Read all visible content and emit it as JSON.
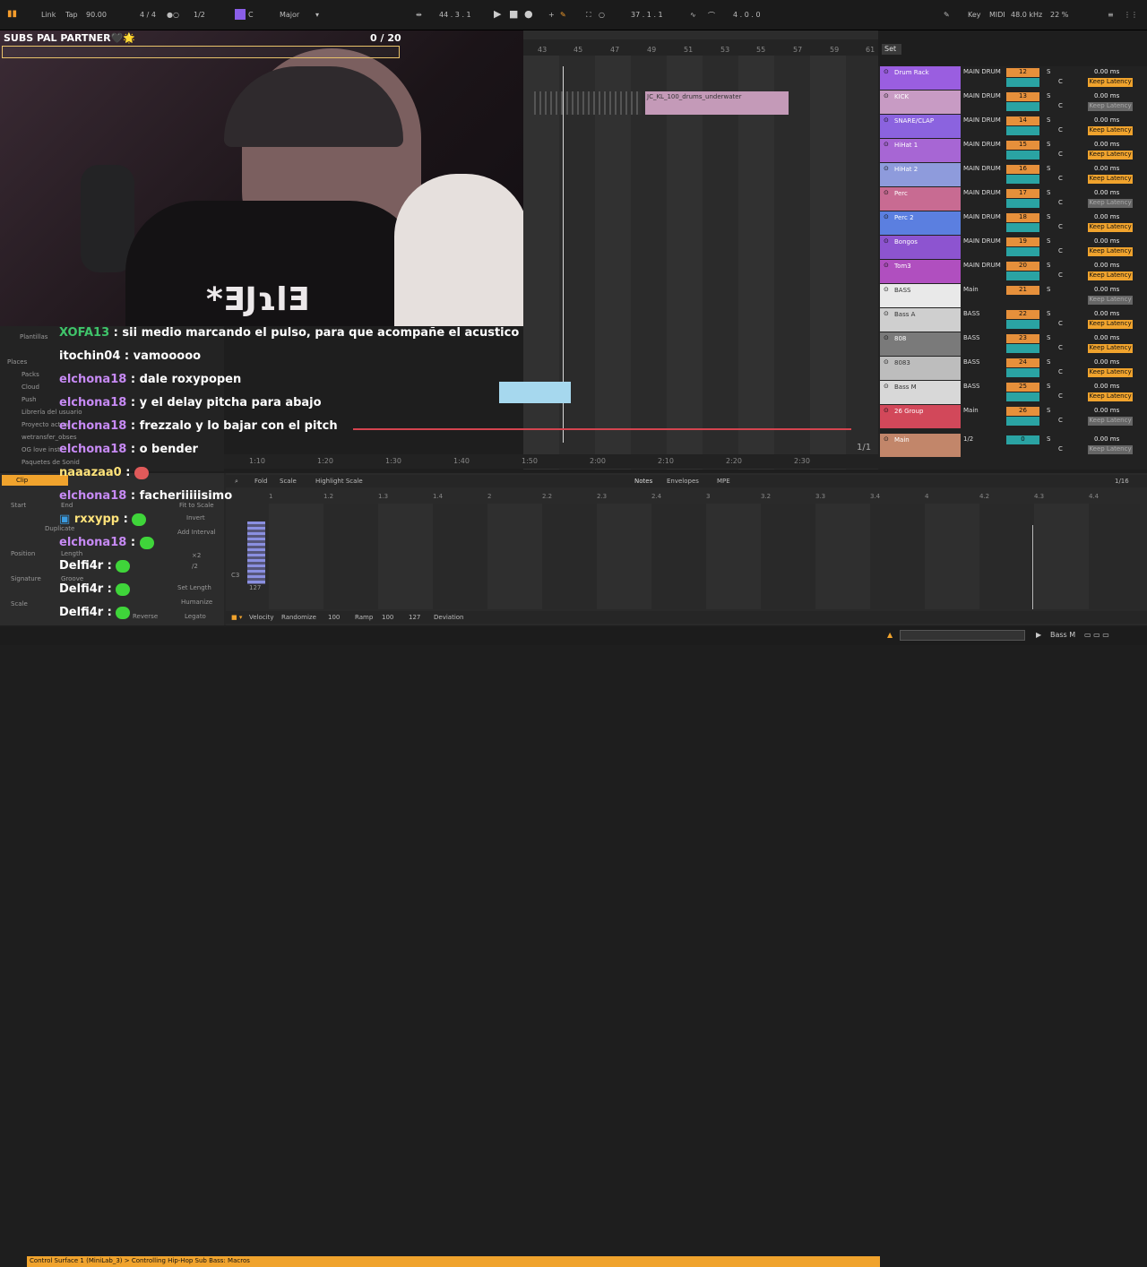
{
  "topbar": {
    "link": "Link",
    "tap": "Tap",
    "tempo": "90.00",
    "signature": "4 / 4",
    "quant": "1/2",
    "key_root": "C",
    "scale": "Major",
    "position": "44 . 3 . 1",
    "loop_pos": "37 . 1 . 1",
    "loop_len": "4 . 0 . 0",
    "key_label": "Key",
    "midi_label": "MIDI",
    "sample_rate": "48.0 kHz",
    "cpu": "22 %"
  },
  "video": {
    "overlay_title": "SUBS PAL PARTNER🖤🌟",
    "overlay_count": "0 / 20",
    "shirt_text": "*ƎJɿlƎ"
  },
  "arrangement": {
    "ruler": [
      "43",
      "45",
      "47",
      "49",
      "51",
      "53",
      "55",
      "57",
      "59",
      "61"
    ],
    "set_label": "Set",
    "clip_name": "JC_KL_100_drums_underwater",
    "timeline": [
      "1:10",
      "1:20",
      "1:30",
      "1:40",
      "1:50",
      "2:00",
      "2:10",
      "2:20",
      "2:30"
    ],
    "page": "1/1"
  },
  "tracks": [
    {
      "name": "Drum Rack",
      "io": "MAIN DRUM",
      "num": "12",
      "val": "0.00 ms",
      "lat": "Keep Latency",
      "color": "#9a5ee0"
    },
    {
      "name": "KICK",
      "io": "MAIN DRUM",
      "num": "13",
      "val": "0.00 ms",
      "lat": "Keep Latency",
      "color": "#c89bc4"
    },
    {
      "name": "SNARE/CLAP",
      "io": "MAIN DRUM",
      "num": "14",
      "val": "0.00 ms",
      "lat": "Keep Latency",
      "color": "#8b63df"
    },
    {
      "name": "HiHat 1",
      "io": "MAIN DRUM",
      "num": "15",
      "val": "0.00 ms",
      "lat": "Keep Latency",
      "color": "#a766d4"
    },
    {
      "name": "HiHat 2",
      "io": "MAIN DRUM",
      "num": "16",
      "val": "0.00 ms",
      "lat": "Keep Latency",
      "color": "#8e9bdc"
    },
    {
      "name": "Perc",
      "io": "MAIN DRUM",
      "num": "17",
      "val": "0.00 ms",
      "lat": "Keep Latency",
      "color": "#c86b92"
    },
    {
      "name": "Perc 2",
      "io": "MAIN DRUM",
      "num": "18",
      "val": "0.00 ms",
      "lat": "Keep Latency",
      "color": "#5b7fe0"
    },
    {
      "name": "Bongos",
      "io": "MAIN DRUM",
      "num": "19",
      "val": "0.00 ms",
      "lat": "Keep Latency",
      "color": "#8d54d0"
    },
    {
      "name": "Tom3",
      "io": "MAIN DRUM",
      "num": "20",
      "val": "0.00 ms",
      "lat": "Keep Latency",
      "color": "#b04fbf"
    },
    {
      "name": "BASS",
      "io": "Main",
      "num": "21",
      "val": "0.00 ms",
      "lat": "Keep Latency",
      "color": "#e9e9e9"
    },
    {
      "name": "Bass A",
      "io": "BASS",
      "num": "22",
      "val": "0.00 ms",
      "lat": "Keep Latency",
      "color": "#cfcfcf"
    },
    {
      "name": "808",
      "io": "BASS",
      "num": "23",
      "val": "0.00 ms",
      "lat": "Keep Latency",
      "color": "#7a7a7a"
    },
    {
      "name": "8083",
      "io": "BASS",
      "num": "24",
      "val": "0.00 ms",
      "lat": "Keep Latency",
      "color": "#bdbdbd"
    },
    {
      "name": "Bass M",
      "io": "BASS",
      "num": "25",
      "val": "0.00 ms",
      "lat": "Keep Latency",
      "color": "#d8d8d8"
    },
    {
      "name": "26 Group",
      "io": "Main",
      "num": "26",
      "val": "0.00 ms",
      "lat": "Keep Latency",
      "color": "#d2485a"
    },
    {
      "name": "Main",
      "io": "1/2",
      "num": "0",
      "val": "0.00 ms",
      "lat": "Keep Latency",
      "color": "#c2866a"
    }
  ],
  "browser": [
    "Plantillas",
    "Places",
    "Packs",
    "Cloud",
    "Push",
    "Librería del usuario",
    "Proyecto actual",
    "wetransfer_obses",
    "OG love instr",
    "Paquetes de Sonid"
  ],
  "chat": [
    {
      "user": "XOFA13",
      "msg": "sii medio marcando el pulso, para que acompañe el acustico",
      "c": "#3fc46a"
    },
    {
      "user": "itochin04",
      "msg": "vamooooo",
      "c": "#ffffff"
    },
    {
      "user": "elchona18",
      "msg": "dale roxypopen",
      "c": "#c78af5"
    },
    {
      "user": "elchona18",
      "msg": "y el delay pitcha para abajo",
      "c": "#c78af5"
    },
    {
      "user": "elchona18",
      "msg": "frezzalo y lo bajar con el pitch",
      "c": "#c78af5"
    },
    {
      "user": "elchona18",
      "msg": "o bender",
      "c": "#c78af5"
    },
    {
      "user": "naaazaa0",
      "msg": "",
      "c": "#ffbf47"
    },
    {
      "user": "elchona18",
      "msg": "facheriiiiisimo",
      "c": "#c78af5"
    },
    {
      "user": "rxxypp",
      "msg": "",
      "c": "#ffbf47"
    },
    {
      "user": "elchona18",
      "msg": "",
      "c": "#c78af5"
    },
    {
      "user": "Delfi4r",
      "msg": "",
      "c": "#ffffff"
    },
    {
      "user": "Delfi4r",
      "msg": "",
      "c": "#ffffff"
    },
    {
      "user": "Delfi4r",
      "msg": "",
      "c": "#ffffff"
    }
  ],
  "clip": {
    "tab": "Clip",
    "start": "Start",
    "end": "End",
    "set": "Set",
    "duplicate": "Duplicate",
    "position": "Position",
    "length": "Length",
    "signature": "Signature",
    "groove": "Groove",
    "scale": "Scale",
    "fit": "Fit to Scale",
    "invert": "Invert",
    "add_interval": "Add Interval",
    "x2": "×2",
    "div2": "/2",
    "set_length": "Set Length",
    "humanize": "Humanize",
    "reverse": "Reverse",
    "legato": "Legato"
  },
  "pianoroll": {
    "fold": "Fold",
    "scale": "Scale",
    "highlight": "Highlight Scale",
    "notes": "Notes",
    "envelopes": "Envelopes",
    "mpe": "MPE",
    "grid": "1/16",
    "ruler": [
      "1",
      "1.2",
      "1.3",
      "1.4",
      "2",
      "2.2",
      "2.3",
      "2.4",
      "3",
      "3.2",
      "3.3",
      "3.4",
      "4",
      "4.2",
      "4.3",
      "4.4"
    ],
    "velocity": "Velocity",
    "randomize": "Randomize",
    "vel_val": "100",
    "ramp": "Ramp",
    "ramp_val": "100",
    "ramp_val2": "127",
    "deviation": "Deviation",
    "key_label": "C3",
    "vel_range": "127"
  },
  "status": {
    "text": "Control Surface 1 (MiniLab_3) > Controlling Hip-Hop Sub Bass: Macros",
    "track": "Bass M"
  }
}
